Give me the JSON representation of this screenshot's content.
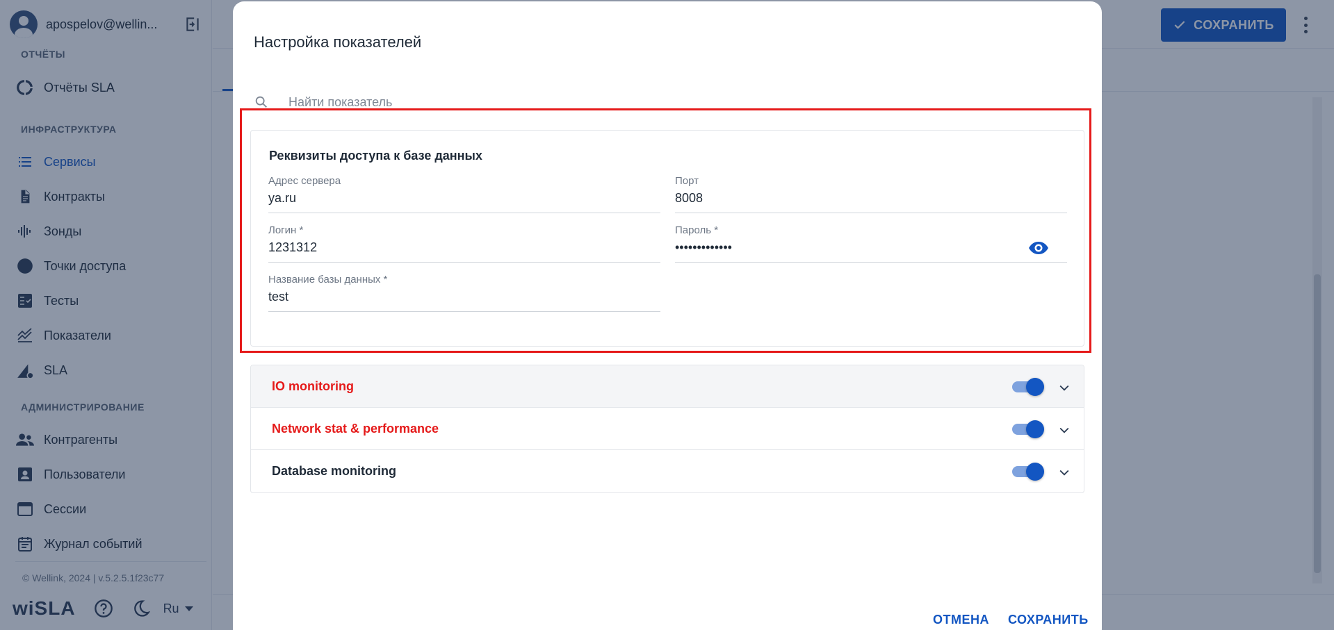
{
  "sidebar": {
    "user": "apospelov@wellin...",
    "sections": {
      "reports": "ОТЧЁТЫ",
      "infra": "ИНФРАСТРУКТУРА",
      "admin": "АДМИНИСТРИРОВАНИЕ"
    },
    "items": {
      "sla_reports": "Отчёты SLA",
      "services": "Сервисы",
      "contracts": "Контракты",
      "probes": "Зонды",
      "access_points": "Точки доступа",
      "tests": "Тесты",
      "metrics": "Показатели",
      "sla": "SLA",
      "counterparties": "Контрагенты",
      "users": "Пользователи",
      "sessions": "Сессии",
      "event_log": "Журнал событий"
    },
    "copyright": "© Wellink, 2024 | v.5.2.5.1f23c77",
    "brand": "wiSLA",
    "lang": "Ru"
  },
  "header": {
    "save_label": "СОХРАНИТЬ"
  },
  "modal": {
    "title": "Настройка показателей",
    "search_placeholder": "Найти показатель",
    "db_card": {
      "title": "Реквизиты доступа к базе данных",
      "server_label": "Адрес сервера",
      "server_value": "ya.ru",
      "port_label": "Порт",
      "port_value": "8008",
      "login_label": "Логин *",
      "login_value": "1231312",
      "password_label": "Пароль *",
      "password_value": "•••••••••••••",
      "dbname_label": "Название базы данных *",
      "dbname_value": "test"
    },
    "sections": [
      {
        "title": "IO monitoring",
        "color": "#e51a1a",
        "enabled": true
      },
      {
        "title": "Network stat & performance",
        "color": "#e51a1a",
        "enabled": true
      },
      {
        "title": "Database monitoring",
        "color": "#1f2a37",
        "enabled": true
      }
    ],
    "cancel_label": "ОТМЕНА",
    "save_label": "СОХРАНИТЬ"
  },
  "colors": {
    "accent": "#1356c2",
    "error": "#e51a1a"
  }
}
